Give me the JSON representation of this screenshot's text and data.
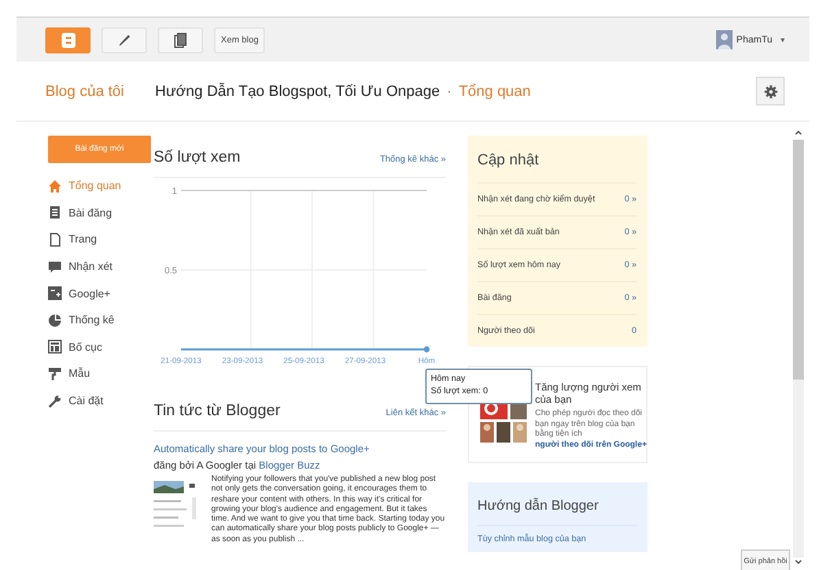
{
  "topbar": {
    "buttons": [
      {
        "kind": "logo"
      },
      {
        "kind": "pencil"
      },
      {
        "kind": "pages"
      },
      {
        "kind": "text",
        "label": "Xem blog"
      }
    ],
    "user": {
      "name": "PhamTu",
      "caret": "▾"
    }
  },
  "header": {
    "home": "Blog của tôi",
    "blog_title": "Hướng Dẫn Tạo Blogspot, Tối Ưu Onpage",
    "separator": "·",
    "page": "Tổng quan"
  },
  "sidebar": {
    "new_post": "Bài đăng mới",
    "items": [
      {
        "label": "Tổng quan",
        "kind": "home",
        "selected": true
      },
      {
        "label": "Bài đăng",
        "kind": "posts",
        "selected": false
      },
      {
        "label": "Trang",
        "kind": "page",
        "selected": false
      },
      {
        "label": "Nhận xét",
        "kind": "comment",
        "selected": false
      },
      {
        "label": "Google+",
        "kind": "gplus",
        "selected": false
      },
      {
        "label": "Thống kê",
        "kind": "stats",
        "selected": false
      },
      {
        "label": "Bố cục",
        "kind": "layout",
        "selected": false
      },
      {
        "label": "Mẫu",
        "kind": "template",
        "selected": false
      },
      {
        "label": "Cài đặt",
        "kind": "settings",
        "selected": false
      }
    ]
  },
  "stats": {
    "title": "Số lượt xem",
    "link": "Thống kê khác »",
    "chart_data": {
      "type": "line",
      "categories": [
        "21-09-2013",
        "23-09-2013",
        "25-09-2013",
        "27-09-2013",
        "Hôm"
      ],
      "series": [
        {
          "color": "#5b9bd5",
          "values": [
            0,
            0,
            0,
            0,
            0
          ]
        }
      ],
      "ylim": [
        0,
        1
      ],
      "yticks": [
        0.5,
        1
      ]
    },
    "tooltip": {
      "title": "Hôm nay",
      "text": "Số lượt xem: 0"
    }
  },
  "news": {
    "title": "Tin tức từ Blogger",
    "link": "Liên kết khác »",
    "post": {
      "title": "Automatically share your blog posts to Google+",
      "byline": "đăng bởi A Googler tại",
      "source": "Blogger Buzz",
      "excerpt": "Notifying your followers that you've published a new blog post not only gets the conversation going, it encourages them to reshare your content with others. In this way it's critical for growing your blog's audience and engagement. But it takes time. And we want to give you that time back. Starting today you can automatically share your blog posts publicly to Google+ — as soon as you publish ..."
    }
  },
  "updates": {
    "title": "Cập nhật",
    "rows": [
      {
        "label": "Nhận xét đang chờ kiểm duyệt",
        "value": "0 »"
      },
      {
        "label": "Nhận xét đã xuất bản",
        "value": "0 »"
      },
      {
        "label": "Số lượt xem hôm nay",
        "value": "0 »"
      },
      {
        "label": "Bài đăng",
        "value": "0 »"
      },
      {
        "label": "Người theo dõi",
        "value": "0"
      }
    ]
  },
  "promo": {
    "title": "Tăng lượng người xem của bạn",
    "text": "Cho phép người đọc theo dõi bạn ngay trên blog của bạn bằng tiện ích",
    "link": "người theo dõi trên Google+"
  },
  "guide": {
    "title": "Hướng dẫn Blogger",
    "links": [
      "Tùy chỉnh mẫu blog của bạn"
    ]
  },
  "feedback": "Gửi phản hồi"
}
